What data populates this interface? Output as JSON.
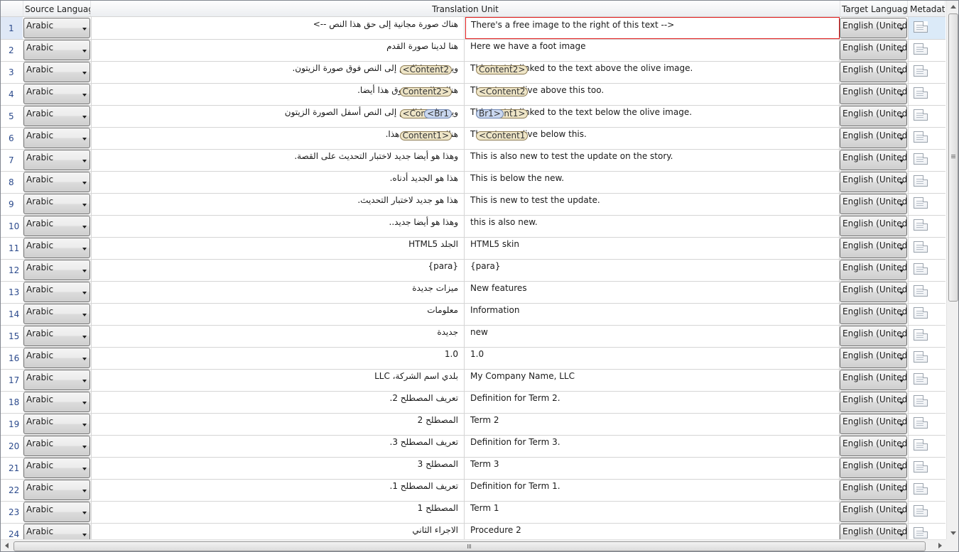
{
  "columns": {
    "source_language": "Source Language",
    "translation_unit": "Translation Unit",
    "target_language": "Target Language",
    "metadata": "Metadata"
  },
  "rows": [
    {
      "n": "1",
      "src_lang": "Arabic",
      "source": "هناك صورة مجانية إلى حق هذا النص -->",
      "target": "There's a free image to the right of this text -->",
      "tgt_lang": "English (United States)",
      "selected": true
    },
    {
      "n": "2",
      "src_lang": "Arabic",
      "source": "هنا لدينا صورة القدم",
      "target": "Here we have a foot image",
      "tgt_lang": "English (United States)"
    },
    {
      "n": "3",
      "src_lang": "Arabic",
      "source": "ويرتبط هذا النص إلى النص فوق صورة الزيتون.",
      "source_tags": [
        {
          "label": "Content2",
          "pos": "end"
        }
      ],
      "target": "This text is linked to the text above the olive image.",
      "target_tags": [
        {
          "label": "Content2",
          "pos": "end"
        }
      ],
      "tgt_lang": "English (United States)"
    },
    {
      "n": "4",
      "src_lang": "Arabic",
      "source": "هناك والزيتون فوق هذا أيضا.",
      "source_tags": [
        {
          "label": "Content2",
          "pos": "start"
        }
      ],
      "target": "There's an olive above this too.",
      "target_tags": [
        {
          "label": "Content2",
          "pos": "start"
        }
      ],
      "tgt_lang": "English (United States)"
    },
    {
      "n": "5",
      "src_lang": "Arabic",
      "source": "ويرتبط هذا النص إلى النص أسفل الصورة الزيتون",
      "source_tags": [
        {
          "label": "Content1",
          "pos": "end"
        },
        {
          "label": "Br1",
          "pos": "end",
          "blue": true
        }
      ],
      "target": "This text is linked to the text below the olive image.",
      "target_tags": [
        {
          "label": "Content1",
          "pos": "end"
        },
        {
          "label": "Br1",
          "pos": "end",
          "blue": true
        }
      ],
      "tgt_lang": "English (United States)"
    },
    {
      "n": "6",
      "src_lang": "Arabic",
      "source": "هناك زيتون دون هذا.",
      "source_tags": [
        {
          "label": "Content1",
          "pos": "start"
        }
      ],
      "target": "There's an olive below this.",
      "target_tags": [
        {
          "label": "Content1",
          "pos": "start"
        }
      ],
      "tgt_lang": "English (United States)"
    },
    {
      "n": "7",
      "src_lang": "Arabic",
      "source": "وهذا هو أيضا جديد لاختبار التحديث على القصة.",
      "target": "This is also new to test the update on the story.",
      "tgt_lang": "English (United States)"
    },
    {
      "n": "8",
      "src_lang": "Arabic",
      "source": "هذا هو الجديد أدناه.",
      "target": "This is below the new.",
      "tgt_lang": "English (United States)"
    },
    {
      "n": "9",
      "src_lang": "Arabic",
      "source": "هذا هو جديد لاختبار التحديث.",
      "target": "This is new to test the update.",
      "tgt_lang": "English (United States)"
    },
    {
      "n": "10",
      "src_lang": "Arabic",
      "source": "وهذا هو أيضا جديد..",
      "target": "this is also new.",
      "tgt_lang": "English (United States)"
    },
    {
      "n": "11",
      "src_lang": "Arabic",
      "source": "الجلد HTML5",
      "target": "HTML5 skin",
      "tgt_lang": "English (United States)"
    },
    {
      "n": "12",
      "src_lang": "Arabic",
      "source": "{para}",
      "target": "{para}",
      "tgt_lang": "English (United States)"
    },
    {
      "n": "13",
      "src_lang": "Arabic",
      "source": "ميزات جديدة",
      "target": "New features",
      "tgt_lang": "English (United States)"
    },
    {
      "n": "14",
      "src_lang": "Arabic",
      "source": "معلومات",
      "target": "Information",
      "tgt_lang": "English (United States)"
    },
    {
      "n": "15",
      "src_lang": "Arabic",
      "source": "جديدة",
      "target": "new",
      "tgt_lang": "English (United States)"
    },
    {
      "n": "16",
      "src_lang": "Arabic",
      "source": "1.0",
      "target": "1.0",
      "tgt_lang": "English (United States)"
    },
    {
      "n": "17",
      "src_lang": "Arabic",
      "source": "بلدي اسم الشركة، LLC",
      "target": "My Company Name, LLC",
      "tgt_lang": "English (United States)"
    },
    {
      "n": "18",
      "src_lang": "Arabic",
      "source": "تعريف المصطلح 2.",
      "target": "Definition for Term 2.",
      "tgt_lang": "English (United States)"
    },
    {
      "n": "19",
      "src_lang": "Arabic",
      "source": "المصطلح 2",
      "target": "Term 2",
      "tgt_lang": "English (United States)"
    },
    {
      "n": "20",
      "src_lang": "Arabic",
      "source": "تعريف المصطلح 3.",
      "target": "Definition for Term 3.",
      "tgt_lang": "English (United States)"
    },
    {
      "n": "21",
      "src_lang": "Arabic",
      "source": "المصطلح 3",
      "target": "Term 3",
      "tgt_lang": "English (United States)"
    },
    {
      "n": "22",
      "src_lang": "Arabic",
      "source": "تعريف المصطلح 1.",
      "target": "Definition for Term 1.",
      "tgt_lang": "English (United States)"
    },
    {
      "n": "23",
      "src_lang": "Arabic",
      "source": "المصطلح 1",
      "target": "Term 1",
      "tgt_lang": "English (United States)"
    },
    {
      "n": "24",
      "src_lang": "Arabic",
      "source": "الاجراء الثاني",
      "target": "Procedure 2",
      "tgt_lang": "English (United States)"
    }
  ],
  "colors": {
    "selected_border": "#e01818",
    "row_number": "#2b4a8c",
    "selected_metadata": "#dbeaf8"
  },
  "icons": {
    "dropdown": "chevron-down-icon",
    "metadata": "document-icon"
  }
}
